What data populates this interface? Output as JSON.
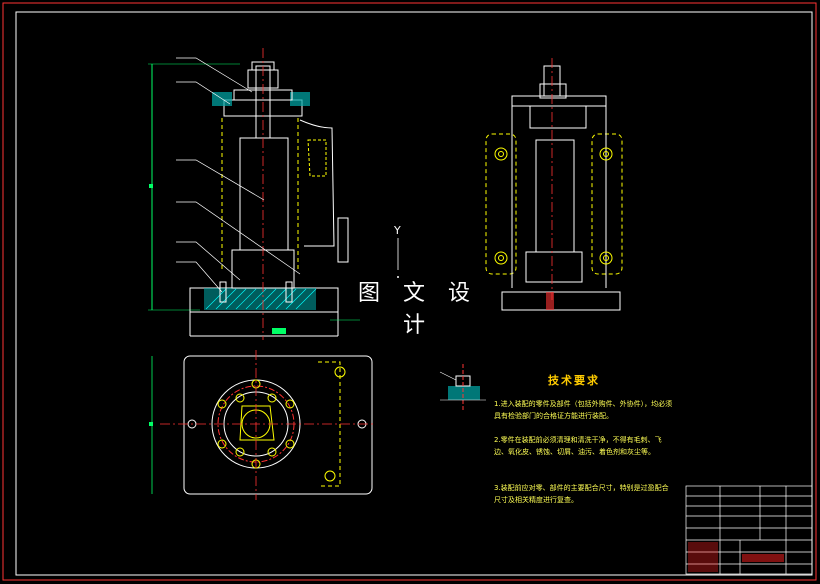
{
  "watermark": "图 文 设 计",
  "view_label": "Y",
  "tech_requirements": {
    "title": "技术要求",
    "items": [
      "1.进入装配的零件及部件（包括外购件、外协件），均必须具有检验部门的合格证方能进行装配。",
      "2.零件在装配前必须清理和清洗干净，不得有毛刺、飞边、氧化皮、锈蚀、切屑、油污、着色剂和灰尘等。",
      "3.装配前应对零、部件的主要配合尺寸，特别是过盈配合尺寸及相关精度进行复查。"
    ]
  },
  "colors": {
    "border": "#ffffff",
    "outline": "#ffffff",
    "hidden": "#ffff00",
    "center": "#ff3333",
    "dimension": "#00ff66",
    "leader": "#ffffff",
    "hatch": "#00cccc",
    "cyan": "#00ffff",
    "title_block": "#ffffff",
    "title_red": "#ff2222"
  }
}
